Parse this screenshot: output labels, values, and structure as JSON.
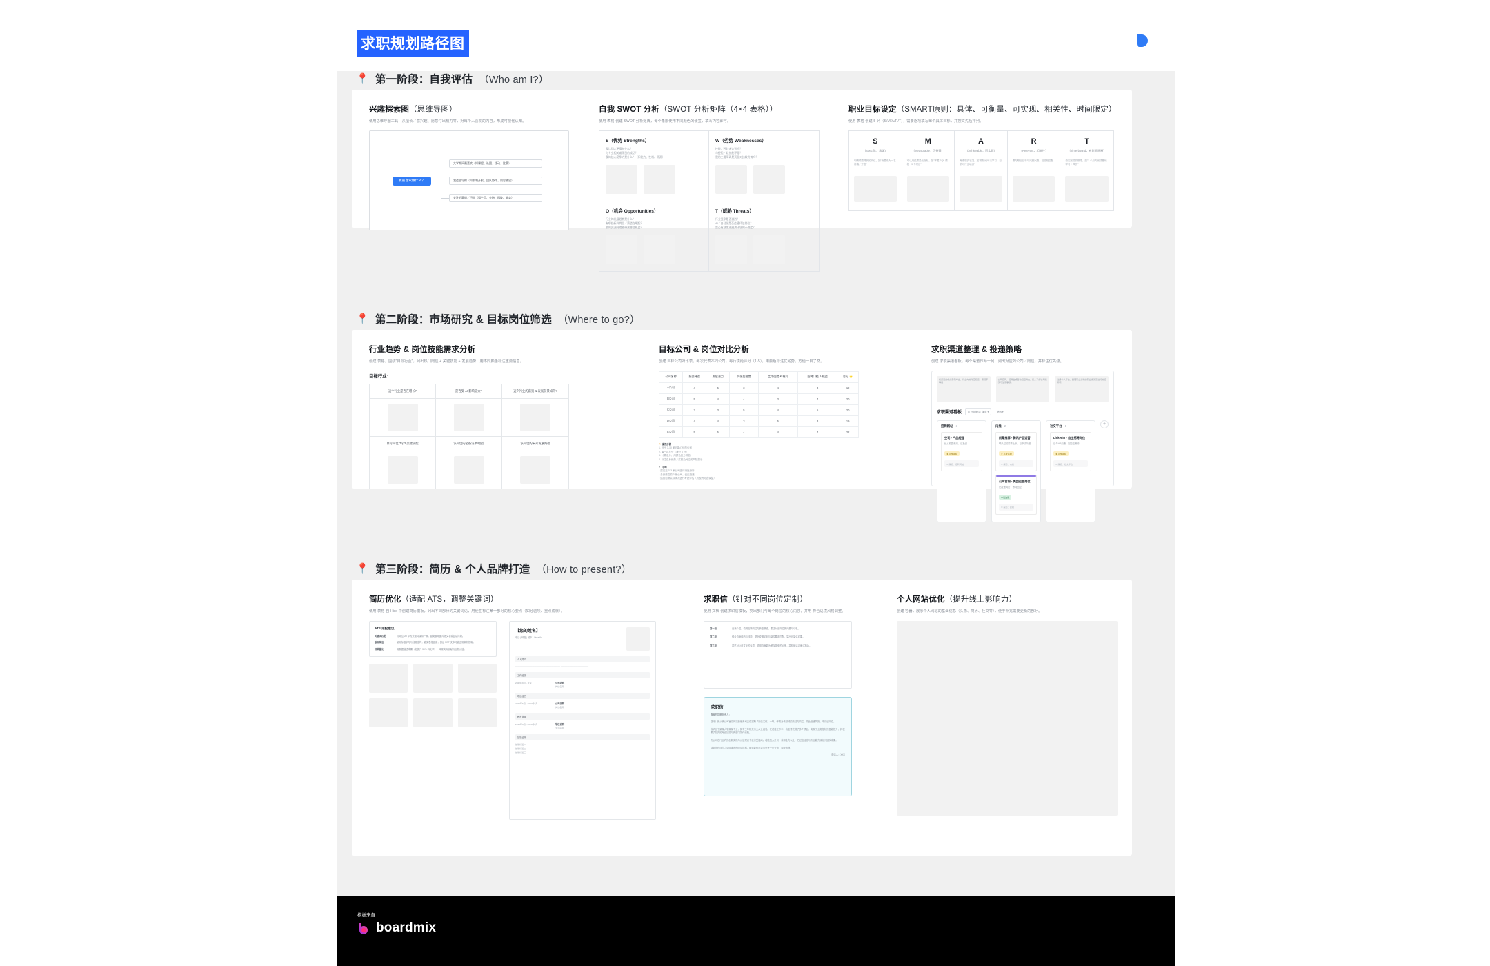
{
  "document": {
    "title": "求职规划路径图",
    "title_highlight_color": "#2563ff",
    "brand_color": "#2f7bf6"
  },
  "footer": {
    "source_label": "模板来自",
    "brand": "boardmix"
  },
  "stages": [
    {
      "pin": "📍",
      "title": "第一阶段：自我评估",
      "english": "（Who am I?）"
    },
    {
      "pin": "📍",
      "title": "第二阶段：市场研究 & 目标岗位筛选",
      "english": "（Where to go?）"
    },
    {
      "pin": "📍",
      "title": "第三阶段：简历 & 个人品牌打造",
      "english": "（How to present?）"
    }
  ],
  "stage1": {
    "mindmap": {
      "title": "兴趣探索图",
      "title_sub": "（思维导图）",
      "desc": "使用思维导图工具，从擅长／感兴趣、愿意付出精力等，对每个人喜欢的内容，形成可视化认知。",
      "root": "我最喜欢做什么？",
      "leaves": [
        "大学期间最喜欢（如课程、社团、活动、比赛）",
        "我会主导做（如前端开发、团队协作、内容输出）",
        "关注的赛道／行业（如产品、金融、科技、教育）"
      ]
    },
    "swot": {
      "title": "自我 SWOT 分析",
      "title_sub": "（SWOT 分析矩阵（4×4 表格））",
      "desc": "使用 表格 创建 SWOT 分析矩阵，每个象限使用不同颜色的便签，填写内容即可。",
      "cells": [
        {
          "heading": "S（优势 Strengths）",
          "questions": "我比别人更擅长什么？\n与专业相关或项目的成功？\n我的核心竞争力是什么？（如能力、性格、资源）"
        },
        {
          "heading": "W（劣势 Weaknesses）",
          "questions": "技能／经验未达到吗？\n与经验／软技能不足？\n我的主要障碍是页面对比较劣势吗？"
        },
        {
          "heading": "O（机会 Opportunities）",
          "questions": "行业的发展趋势是什么？\n有哪些新兴岗位／赛道在崛起？\n我的资源网络能带来哪些机会？"
        },
        {
          "heading": "T（威胁 Threats）",
          "questions": "行业竞争是否激烈？\nAI／自动化是否会替代该岗位？\n是否有政策或经济环境的不确定？"
        }
      ]
    },
    "smart": {
      "title": "职业目标设定",
      "title_sub": "（SMART原则：具体、可衡量、可实现、相关性、时间限定）",
      "desc": "使用 表格 创建 5 列（S/M/A/R/T），需要逐项填写每个具体目标，并按文先后排列。",
      "columns": [
        {
          "letter": "S",
          "en": "(Specific，具体)",
          "tip": "明确想要得到的岗位，如\"我要成为一名前端／开发\""
        },
        {
          "letter": "M",
          "en": "(Measurable，可衡量)",
          "tip": "可以用结果量化指标，如\"掌握 SQL 课程 +3 个项目\""
        },
        {
          "letter": "A",
          "en": "(Achievable，可实现)",
          "tip": "考虑现实状况，如\"现阶段可以学习、目前可行业培训\""
        },
        {
          "letter": "R",
          "en": "(Relevant，相关性)",
          "tip": "需与职业目标与兴趣兴趣、技能相匹配"
        },
        {
          "letter": "T",
          "en": "(Time-bound，有时间限制)",
          "tip": "设定完成的期限，如\"3 个月内完成基础学习 + 简历\""
        }
      ]
    }
  },
  "stage2": {
    "industry": {
      "title": "行业趋势 & 岗位技能需求分析",
      "desc": "创建 表格，围绕\"目标行业\"，列出热门岗位 + 关键技能 + 发展趋势，用不同颜色标注重要信息。",
      "label": "目标行业:",
      "questions_row1": [
        "这个行业是否在增长?",
        "是否受 AI 影响较大?",
        "这个行业的薪资 & 发展前景如何?"
      ],
      "questions_row2": [
        "目标岗位 Top3 关键技能",
        "该岗位的必备证书/经验",
        "该岗位的未来发展路径"
      ]
    },
    "company": {
      "title": "目标公司 & 岗位对比分析",
      "desc": "创建 目标公司对比表，每次代表不同公司，每行填给评分（1-5），用颜色标注优劣势，方便一目了然。",
      "headers": [
        "公司名称",
        "薪资待遇",
        "发展潜力",
        "文化契合度",
        "工作强度 & 福利",
        "招聘门槛 & 机会",
        "总分 ⭐"
      ],
      "rows": [
        [
          "A公司",
          "4",
          "5",
          "3",
          "4",
          "3",
          "19"
        ],
        [
          "B公司",
          "5",
          "4",
          "4",
          "3",
          "4",
          "20"
        ],
        [
          "C公司",
          "3",
          "3",
          "5",
          "4",
          "5",
          "20"
        ],
        [
          "D公司",
          "4",
          "4",
          "3",
          "5",
          "3",
          "19"
        ],
        [
          "E公司",
          "5",
          "5",
          "4",
          "4",
          "4",
          "22"
        ]
      ],
      "legend_title": "操作步骤",
      "legend_lines": [
        "1. 列出 3-10 家可能心仪的公司",
        "2. 每一项打分（满分 5 分）",
        "3. 计算总分，用颜色区分排名",
        "4. 标注自身优势／劣势及对应的风险提示"
      ],
      "tips_title": "⚡ Tips：",
      "tips_lines": [
        "• 建议至少 3 家公司进行对比分析",
        "• 总分最高的 3 家公司，优先投递",
        "• 结合自身实际情况进行考虑评估（可视为动态调整）"
      ]
    },
    "channels": {
      "title": "求职渠道整理 & 投递策略",
      "desc": "创建 求职渠道看板，每个渠道作为一列，列出对应的公司／岗位，并标注优先级。",
      "top_notes": [
        "将渠道的优劣势列举出，行业内的对应渠道，按频率等级",
        "公司官网、招聘会或者校园招聘会、投入了解公司情况与注意事项。",
        "注册个人平台，整理职业资料的职业素养及进行的招聘项"
      ],
      "board_title": "求职渠道看板",
      "board_chip1": "⊞ 分组条件：渠道 ▾",
      "board_chip2": "筛选 ▾",
      "columns": [
        {
          "name": "招聘网站",
          "count": "3",
          "bar_color": "#3a3a3a",
          "cards": [
            {
              "title": "空司 - 产品经理",
              "desc": "经从校园来岗、已投递",
              "tag": "★ 高优先级",
              "tag_type": "y",
              "footer": "⊙ 渠道：招聘网站"
            }
          ]
        },
        {
          "name": "内推",
          "count": "2",
          "bar_color": "#4ad3c3",
          "cards": [
            {
              "title": "前辈推荐 - 腾讯产品运营",
              "desc": "联系过前同事上序、已申请內推",
              "tag": "★ 高优先级",
              "tag_type": "y",
              "footer": "⊙ 渠道：内推"
            },
            {
              "title": "公司官网 - 美团运营岗位",
              "desc": "已投递简历，等待回复",
              "tag": "中优先级",
              "tag_type": "g",
              "footer": "⊙ 渠道：官网"
            }
          ]
        },
        {
          "name": "社交平台",
          "count": "1",
          "bar_color": "#d66ae6",
          "cards": [
            {
              "title": "LinkedIn - 自主招聘岗位",
              "desc": "已与HR沟通、回复正等待",
              "tag": "★ 高优先级",
              "tag_type": "y",
              "footer": "⊙ 渠道：社交平台"
            }
          ]
        }
      ],
      "add_label": "+"
    }
  },
  "stage3": {
    "resume": {
      "title": "简历优化",
      "title_sub": "（适配 ATS，调整关键词）",
      "desc": "使用 表格 自 Hire 中创建简历模板，列出不同部分的关键词语，用便签标注某一部分的核心要点（如经验项、重点成就）。",
      "ats": {
        "heading": "ATS 适配建议",
        "rows": [
          {
            "k": "关键词匹配",
            "v": "与岗位 JD 中的关键词保持一致，避免使用图片化文字或复杂排版。"
          },
          {
            "k": "版面简洁",
            "v": "使用标准字号与段落结构，避免表格嵌套，保证 PDF 文本可被正常解析提取。"
          },
          {
            "k": "成果量化",
            "v": "用数据描述成果（如提升 30% 转化率），体现实际贡献与业务价值。"
          }
        ]
      },
      "preview": {
        "name": "【您的姓名】",
        "contact": "电话 | 邮箱 | 城市 | LinkedIn",
        "sections": [
          "个人简介",
          "工作经历",
          "项目经历",
          "教育背景",
          "技能证书"
        ],
        "entries": [
          {
            "date": "2022年9月 - 至今",
            "org": "公司名称",
            "role": "岗位名称"
          },
          {
            "date": "2020年6月 - 2022年8月",
            "org": "公司名称",
            "role": "岗位名称"
          },
          {
            "date": "2016年9月 - 2020年6月",
            "org": "学校名称",
            "role": "专业名称"
          }
        ],
        "skills": [
          "技能标签一",
          "技能标签二",
          "技能标签三"
        ]
      }
    },
    "cover": {
      "title": "求职信",
      "title_sub": "（针对不同岗位定制）",
      "desc": "使用 文档 创建求职信模板，突出部门与每个岗位的核心内容，并用 符合语境风格调整。",
      "guide": [
        {
          "k": "第一段",
          "v": "自我介绍，说明应聘岗位与获取渠道，表达对该岗位的兴趣与动机。"
        },
        {
          "k": "第二段",
          "v": "结合自身经历与技能，举例说明如何与岗位要求匹配，突出可量化成果。"
        },
        {
          "k": "第三段",
          "v": "表达对公司文化的认同，说明自身能为团队带来的价值，并礼貌请求面试机会。"
        }
      ],
      "letter_title": "求职信",
      "letter_sub": "尊敬的招聘负责人：",
      "letter_body": [
        "您好！我从贵公司官方网站获悉贵司正在招聘「岗位名称」一职，怀着对该领域的热忱与向往，特此投递简历，申请该岗位。",
        "我毕业于某某大学某某专业，拥有三年相关行业从业经验。在过往工作中，我主导完成了多个项目，实现了业务指标的显著提升，并积累了扎实的专业技能与跨部门协作经验。",
        "贵公司在行业内的创新实践与价值理念令我深受触动。若能加入贵司，我将全力以赴，把过往经验与专业能力转化为团队成果。",
        "感谢您在百忙之中阅读我的申请材料，期待能有机会与您进一步交流。顺祝商祺！"
      ],
      "signature": "申请人：XXX"
    },
    "website": {
      "title": "个人网站优化",
      "title_sub": "（提升线上影响力）",
      "desc": "创建 容器，展示个人网站的基础信息（头像、简历、社交等），便于补充需要更新的部分。"
    }
  }
}
